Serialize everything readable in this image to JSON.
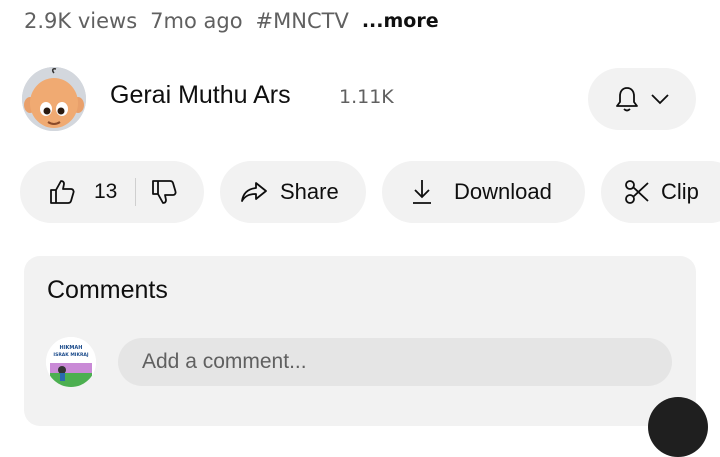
{
  "video_meta": {
    "views": "2.9K views",
    "age": "7mo ago",
    "hashtag": "#MNCTV",
    "more_label": "...more"
  },
  "channel": {
    "name": "Gerai Muthu Ars",
    "subscribers": "1.11K",
    "avatar_icon": "cartoon-boy-avatar",
    "bell_icon": "bell-icon",
    "chevron_icon": "chevron-down-icon"
  },
  "actions": {
    "like_count": "13",
    "share_label": "Share",
    "download_label": "Download",
    "clip_label": "Clip"
  },
  "comments": {
    "title": "Comments",
    "placeholder": "Add a comment...",
    "user_avatar_text": [
      "HIKMAH",
      "ISRAK MIKRAJ"
    ]
  },
  "colors": {
    "pill_bg": "#f2f2f2",
    "secondary_text": "#606060",
    "primary_text": "#0f0f0f"
  }
}
